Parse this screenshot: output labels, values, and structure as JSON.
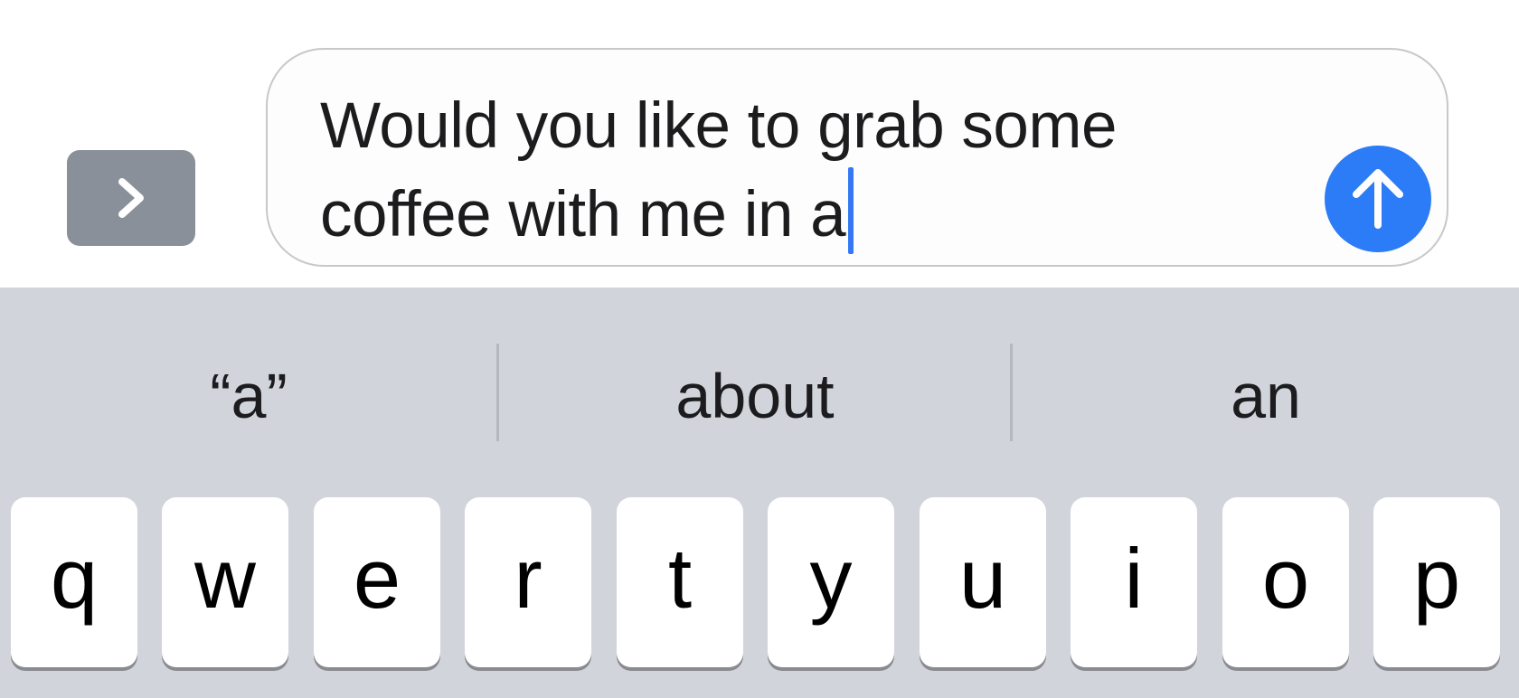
{
  "compose": {
    "expand_icon": "chevron-right-icon",
    "message_text": "Would you like to grab some\ncoffee with me in a",
    "send_icon": "arrow-up-icon",
    "send_color": "#2b7cf6",
    "cursor_color": "#3478f6"
  },
  "keyboard": {
    "suggestions": [
      "“a”",
      "about",
      "an"
    ],
    "keys": [
      "q",
      "w",
      "e",
      "r",
      "t",
      "y",
      "u",
      "i",
      "o",
      "p"
    ],
    "background": "#d1d4db"
  }
}
